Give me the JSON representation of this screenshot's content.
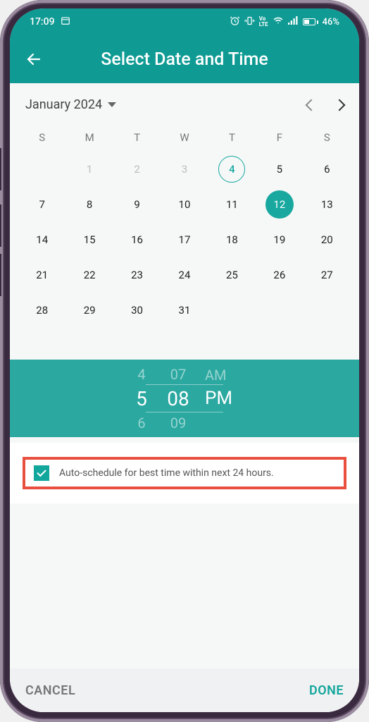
{
  "status": {
    "time": "17:09",
    "battery_pct": "46%"
  },
  "header": {
    "title": "Select Date and Time"
  },
  "calendar": {
    "month_label": "January 2024",
    "dow": [
      "S",
      "M",
      "T",
      "W",
      "T",
      "F",
      "S"
    ],
    "leading_blanks": 1,
    "muted_days": [
      1,
      2,
      3
    ],
    "today": 4,
    "selected": 12,
    "days_in_month": 31
  },
  "time_picker": {
    "hour_prev": "4",
    "hour": "5",
    "hour_next": "6",
    "minute_prev": "07",
    "minute": "08",
    "minute_next": "09",
    "ampm_prev": "AM",
    "ampm": "PM"
  },
  "auto_schedule": {
    "checked": true,
    "label": "Auto-schedule for best time within next 24 hours."
  },
  "footer": {
    "cancel": "CANCEL",
    "done": "DONE"
  }
}
